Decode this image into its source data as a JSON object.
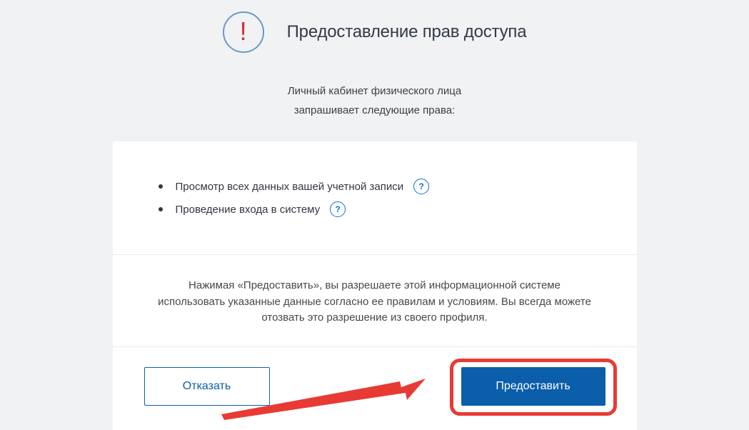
{
  "header": {
    "title": "Предоставление прав доступа"
  },
  "subtitle": {
    "line1": "Личный кабинет физического лица",
    "line2": "запрашивает следующие права:"
  },
  "permissions": [
    {
      "text": "Просмотр всех данных вашей учетной записи"
    },
    {
      "text": "Проведение входа в систему"
    }
  ],
  "disclaimer": "Нажимая «Предоставить», вы разрешаете этой информационной системе использовать указанные данные согласно ее правилам и условиям. Вы всегда можете отозвать это разрешение из своего профиля.",
  "buttons": {
    "deny": "Отказать",
    "allow": "Предоставить"
  },
  "helpGlyph": "?"
}
